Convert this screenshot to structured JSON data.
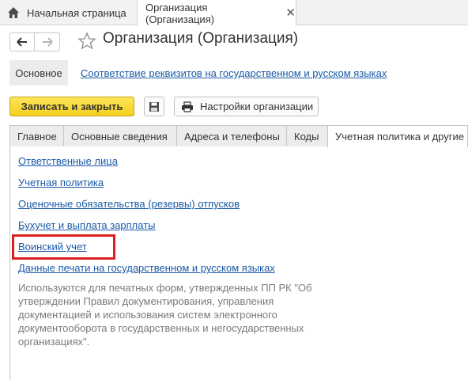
{
  "tabs": {
    "home_label": "Начальная страница",
    "active_label": "Организация (Организация)"
  },
  "header": {
    "title": "Организация (Организация)"
  },
  "section_panel": {
    "main_label": "Основное",
    "link_label": "Соответствие реквизитов на государственном и русском языках"
  },
  "toolbar": {
    "save_close_label": "Записать и закрыть",
    "settings_label": "Настройки организации"
  },
  "form_tabs": [
    "Главное",
    "Основные сведения",
    "Адреса и телефоны",
    "Коды",
    "Учетная политика и другие настройки"
  ],
  "links": [
    "Ответственные лица",
    "Учетная политика",
    "Оценочные обязательства (резервы) отпусков",
    "Бухучет и выплата зарплаты",
    "Воинский учет",
    "Данные печати на государственном и русском языках"
  ],
  "description": "Используются для печатных форм, утвержденных ПП РК \"Об утверждении Правил документирования, управления документацией и использования систем электронного документооборота в государственных и негосударственных организациях\".",
  "colors": {
    "accent_yellow": "#f5cf1d",
    "link_blue": "#1a5aa8",
    "highlight_red": "#e01e1e"
  }
}
